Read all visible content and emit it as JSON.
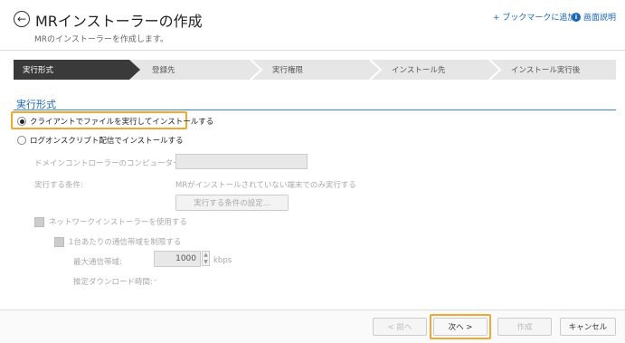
{
  "header": {
    "title": "MRインストーラーの作成",
    "subtitle": "MRのインストーラーを作成します。",
    "bookmark_link": "+ ブックマークに追加",
    "help_link": "画面説明"
  },
  "steps": [
    {
      "label": "実行形式",
      "active": true
    },
    {
      "label": "登録先",
      "active": false
    },
    {
      "label": "実行権限",
      "active": false
    },
    {
      "label": "インストール先",
      "active": false
    },
    {
      "label": "インストール実行後",
      "active": false
    }
  ],
  "section": {
    "title": "実行形式"
  },
  "options": {
    "client_install": "クライアントでファイルを実行してインストールする",
    "logon_script": "ログオンスクリプト配信でインストールする"
  },
  "logon_settings": {
    "domain_controller_label": "ドメインコントローラーのコンピューター名*:",
    "domain_controller_value": "",
    "condition_label": "実行する条件:",
    "condition_text": "MRがインストールされていない端末でのみ実行する",
    "condition_button": "実行する条件の設定...",
    "use_network_installer": "ネットワークインストーラーを使用する",
    "limit_bandwidth": "1台あたりの通信帯域を制限する",
    "max_bandwidth_label": "最大通信帯域:",
    "max_bandwidth_value": "1000",
    "max_bandwidth_unit": "kbps",
    "estimated_time_label": "推定ダウンロード時間:",
    "estimated_time_value": "-"
  },
  "footer": {
    "prev_label": "< 前へ",
    "next_label": "次へ >",
    "create_label": "作成",
    "cancel_label": "キャンセル"
  },
  "colors": {
    "active_step": "#3a3a3a",
    "inactive_step": "#e6e6e6",
    "accent": "#1a66b5",
    "highlight": "#f0a830"
  }
}
